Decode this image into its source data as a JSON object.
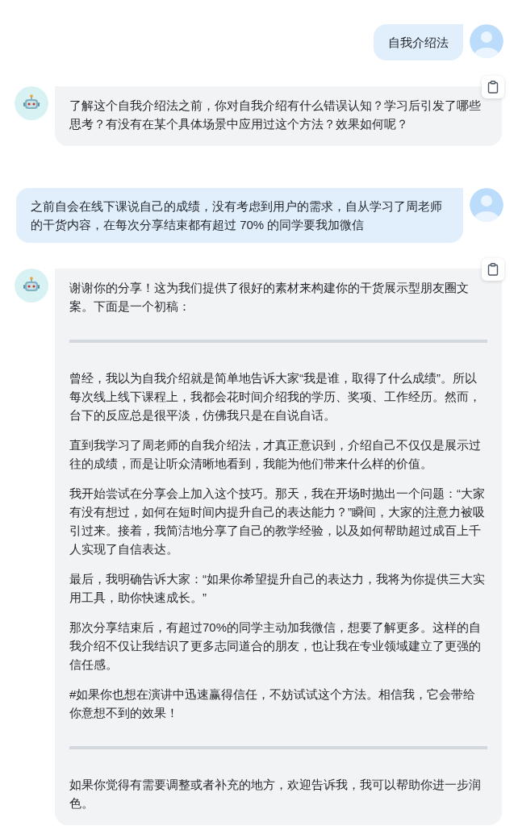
{
  "messages": [
    {
      "kind": "user",
      "text": "自我介绍法"
    },
    {
      "kind": "bot",
      "blocks": [
        {
          "kind": "paragraph",
          "text": "了解这个自我介绍法之前，你对自我介绍有什么错误认知？学习后引发了哪些思考？有没有在某个具体场景中应用过这个方法？效果如何呢？"
        }
      ]
    },
    {
      "kind": "user",
      "text": "之前自会在线下课说自己的成绩，没有考虑到用户的需求，自从学习了周老师的干货内容，在每次分享结束都有超过 70% 的同学要我加微信"
    },
    {
      "kind": "bot",
      "blocks": [
        {
          "kind": "paragraph",
          "text": "谢谢你的分享！这为我们提供了很好的素材来构建你的干货展示型朋友圈文案。下面是一个初稿："
        },
        {
          "kind": "rule"
        },
        {
          "kind": "paragraph",
          "text": "曾经，我以为自我介绍就是简单地告诉大家“我是谁，取得了什么成绩”。所以每次线上线下课程上，我都会花时间介绍我的学历、奖项、工作经历。然而，台下的反应总是很平淡，仿佛我只是在自说自话。"
        },
        {
          "kind": "paragraph",
          "text": "直到我学习了周老师的自我介绍法，才真正意识到，介绍自己不仅仅是展示过往的成绩，而是让听众清晰地看到，我能为他们带来什么样的价值。"
        },
        {
          "kind": "paragraph",
          "text": "我开始尝试在分享会上加入这个技巧。那天，我在开场时抛出一个问题：“大家有没有想过，如何在短时间内提升自己的表达能力？”瞬间，大家的注意力被吸引过来。接着，我简洁地分享了自己的教学经验，以及如何帮助超过成百上千人实现了自信表达。"
        },
        {
          "kind": "paragraph",
          "text": "最后，我明确告诉大家：“如果你希望提升自己的表达力，我将为你提供三大实用工具，助你快速成长。”"
        },
        {
          "kind": "paragraph",
          "text": "那次分享结束后，有超过70%的同学主动加我微信，想要了解更多。这样的自我介绍不仅让我结识了更多志同道合的朋友，也让我在专业领域建立了更强的信任感。"
        },
        {
          "kind": "paragraph",
          "text": "#如果你也想在演讲中迅速赢得信任，不妨试试这个方法。相信我，它会带给你意想不到的效果！"
        },
        {
          "kind": "rule"
        },
        {
          "kind": "paragraph",
          "text": "如果你觉得有需要调整或者补充的地方，欢迎告诉我，我可以帮助你进一步润色。"
        }
      ]
    }
  ]
}
